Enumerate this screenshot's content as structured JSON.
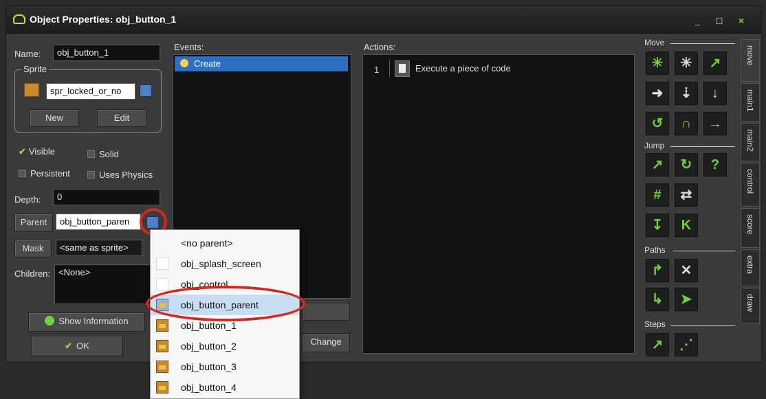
{
  "window": {
    "title": "Object Properties: obj_button_1",
    "controls": [
      "_",
      "□",
      "×"
    ]
  },
  "left": {
    "name_label": "Name:",
    "name_value": "obj_button_1",
    "sprite_group": "Sprite",
    "sprite_value": "spr_locked_or_no",
    "new_button": "New",
    "edit_button": "Edit",
    "visible_label": "Visible",
    "visible_checked": true,
    "solid_label": "Solid",
    "persistent_label": "Persistent",
    "uses_physics_label": "Uses Physics",
    "depth_label": "Depth:",
    "depth_value": "0",
    "parent_button": "Parent",
    "parent_value": "obj_button_paren",
    "mask_button": "Mask",
    "mask_value": "<same as sprite>",
    "children_label": "Children:",
    "children_value": "<None>",
    "show_info_button": "Show Information",
    "ok_button": "OK"
  },
  "events": {
    "label": "Events:",
    "items": [
      "Create"
    ],
    "change_button": "Change"
  },
  "actions": {
    "label": "Actions:",
    "items": [
      {
        "num": "1",
        "text": "Execute a piece of code"
      }
    ]
  },
  "tool_palette": {
    "sections": [
      "Move",
      "Jump",
      "Paths",
      "Steps"
    ],
    "tabs": [
      "move",
      "main1",
      "main2",
      "control",
      "score",
      "extra",
      "draw"
    ]
  },
  "parent_dropdown": {
    "items": [
      {
        "label": "<no parent>",
        "icon": "none"
      },
      {
        "label": "obj_splash_screen",
        "icon": "empty"
      },
      {
        "label": "obj_control",
        "icon": "empty"
      },
      {
        "label": "obj_button_parent",
        "icon": "object",
        "selected": true
      },
      {
        "label": "obj_button_1",
        "icon": "object"
      },
      {
        "label": "obj_button_2",
        "icon": "object"
      },
      {
        "label": "obj_button_3",
        "icon": "object"
      },
      {
        "label": "obj_button_4",
        "icon": "object"
      }
    ]
  },
  "colors": {
    "selection_blue": "#2f6fc3",
    "dropdown_highlight": "#c7ddf2",
    "annotation_red": "#d2291e",
    "tool_green": "#6fd23c"
  }
}
